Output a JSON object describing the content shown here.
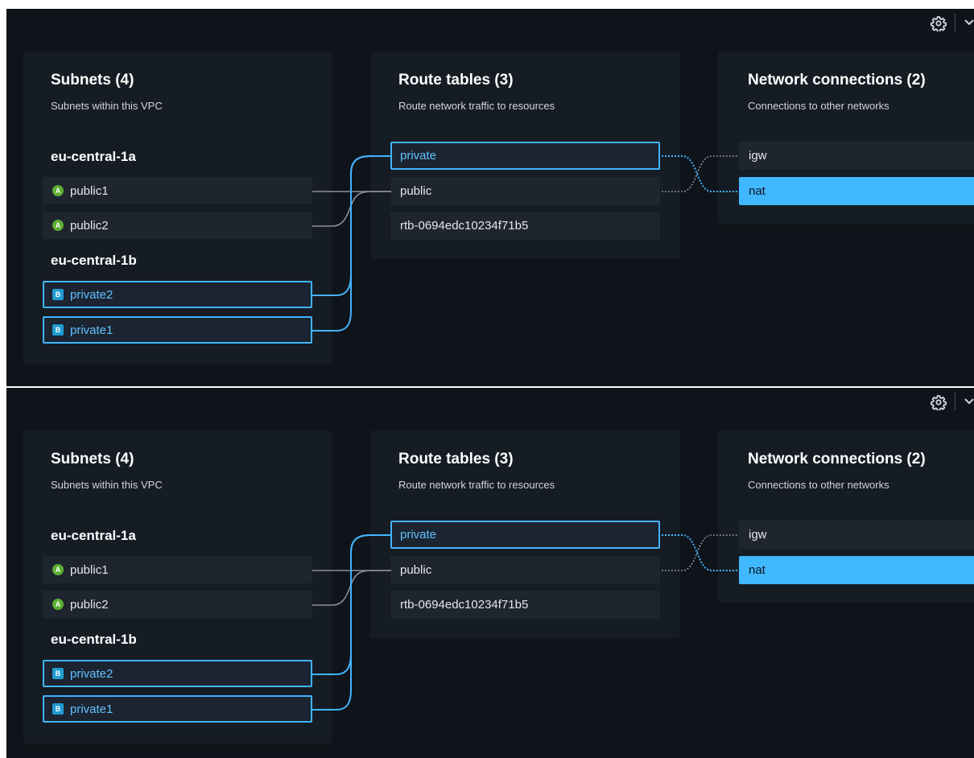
{
  "panels": [
    {
      "subnets": {
        "title": "Subnets (4)",
        "subtitle": "Subnets within this VPC",
        "zones": [
          {
            "name": "eu-central-1a",
            "items": [
              {
                "badge": "A",
                "label": "public1"
              },
              {
                "badge": "A",
                "label": "public2"
              }
            ]
          },
          {
            "name": "eu-central-1b",
            "items": [
              {
                "badge": "B",
                "label": "private2"
              },
              {
                "badge": "B",
                "label": "private1"
              }
            ]
          }
        ]
      },
      "route_tables": {
        "title": "Route tables (3)",
        "subtitle": "Route network traffic to resources",
        "items": [
          {
            "label": "private"
          },
          {
            "label": "public"
          },
          {
            "label": "rtb-0694edc10234f71b5"
          }
        ]
      },
      "network_connections": {
        "title": "Network connections (2)",
        "subtitle": "Connections to other networks",
        "items": [
          {
            "label": "igw"
          },
          {
            "label": "nat"
          }
        ]
      }
    },
    {
      "subnets": {
        "title": "Subnets (4)",
        "subtitle": "Subnets within this VPC",
        "zones": [
          {
            "name": "eu-central-1a",
            "items": [
              {
                "badge": "A",
                "label": "public1"
              },
              {
                "badge": "A",
                "label": "public2"
              }
            ]
          },
          {
            "name": "eu-central-1b",
            "items": [
              {
                "badge": "B",
                "label": "private2"
              },
              {
                "badge": "B",
                "label": "private1"
              }
            ]
          }
        ]
      },
      "route_tables": {
        "title": "Route tables (3)",
        "subtitle": "Route network traffic to resources",
        "items": [
          {
            "label": "private"
          },
          {
            "label": "public"
          },
          {
            "label": "rtb-0694edc10234f71b5"
          }
        ]
      },
      "network_connections": {
        "title": "Network connections (2)",
        "subtitle": "Connections to other networks",
        "items": [
          {
            "label": "igw"
          },
          {
            "label": "nat"
          }
        ]
      }
    }
  ],
  "colors": {
    "background": "#0f141a",
    "column_background": "#161c24",
    "row_background": "#1e252f",
    "selected_accent": "#42b4ff",
    "active_background": "#40b8ff",
    "public_badge": "#5cae33",
    "private_badge": "#1f9bd1",
    "link_gray": "#8a8f99"
  },
  "icons": {
    "settings": "gear-icon",
    "collapse": "chevron-down-icon"
  }
}
